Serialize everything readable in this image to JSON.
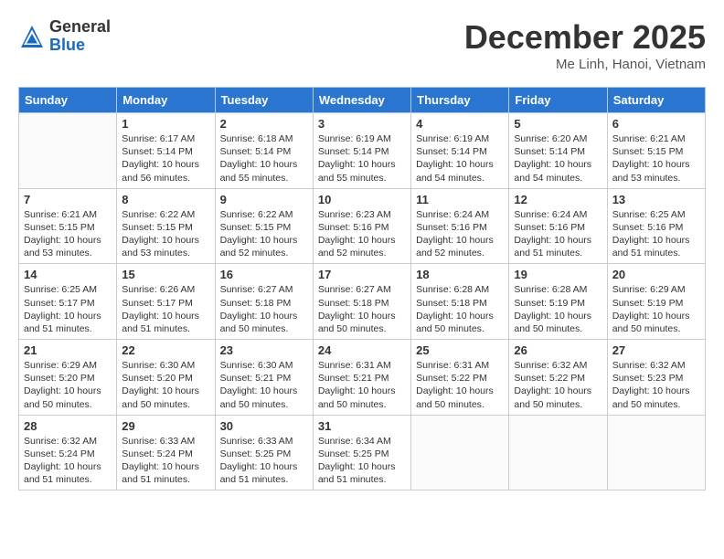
{
  "header": {
    "logo_general": "General",
    "logo_blue": "Blue",
    "month_title": "December 2025",
    "location": "Me Linh, Hanoi, Vietnam"
  },
  "calendar": {
    "days_of_week": [
      "Sunday",
      "Monday",
      "Tuesday",
      "Wednesday",
      "Thursday",
      "Friday",
      "Saturday"
    ],
    "weeks": [
      [
        {
          "day": "",
          "info": ""
        },
        {
          "day": "1",
          "info": "Sunrise: 6:17 AM\nSunset: 5:14 PM\nDaylight: 10 hours\nand 56 minutes."
        },
        {
          "day": "2",
          "info": "Sunrise: 6:18 AM\nSunset: 5:14 PM\nDaylight: 10 hours\nand 55 minutes."
        },
        {
          "day": "3",
          "info": "Sunrise: 6:19 AM\nSunset: 5:14 PM\nDaylight: 10 hours\nand 55 minutes."
        },
        {
          "day": "4",
          "info": "Sunrise: 6:19 AM\nSunset: 5:14 PM\nDaylight: 10 hours\nand 54 minutes."
        },
        {
          "day": "5",
          "info": "Sunrise: 6:20 AM\nSunset: 5:14 PM\nDaylight: 10 hours\nand 54 minutes."
        },
        {
          "day": "6",
          "info": "Sunrise: 6:21 AM\nSunset: 5:15 PM\nDaylight: 10 hours\nand 53 minutes."
        }
      ],
      [
        {
          "day": "7",
          "info": "Sunrise: 6:21 AM\nSunset: 5:15 PM\nDaylight: 10 hours\nand 53 minutes."
        },
        {
          "day": "8",
          "info": "Sunrise: 6:22 AM\nSunset: 5:15 PM\nDaylight: 10 hours\nand 53 minutes."
        },
        {
          "day": "9",
          "info": "Sunrise: 6:22 AM\nSunset: 5:15 PM\nDaylight: 10 hours\nand 52 minutes."
        },
        {
          "day": "10",
          "info": "Sunrise: 6:23 AM\nSunset: 5:16 PM\nDaylight: 10 hours\nand 52 minutes."
        },
        {
          "day": "11",
          "info": "Sunrise: 6:24 AM\nSunset: 5:16 PM\nDaylight: 10 hours\nand 52 minutes."
        },
        {
          "day": "12",
          "info": "Sunrise: 6:24 AM\nSunset: 5:16 PM\nDaylight: 10 hours\nand 51 minutes."
        },
        {
          "day": "13",
          "info": "Sunrise: 6:25 AM\nSunset: 5:16 PM\nDaylight: 10 hours\nand 51 minutes."
        }
      ],
      [
        {
          "day": "14",
          "info": "Sunrise: 6:25 AM\nSunset: 5:17 PM\nDaylight: 10 hours\nand 51 minutes."
        },
        {
          "day": "15",
          "info": "Sunrise: 6:26 AM\nSunset: 5:17 PM\nDaylight: 10 hours\nand 51 minutes."
        },
        {
          "day": "16",
          "info": "Sunrise: 6:27 AM\nSunset: 5:18 PM\nDaylight: 10 hours\nand 50 minutes."
        },
        {
          "day": "17",
          "info": "Sunrise: 6:27 AM\nSunset: 5:18 PM\nDaylight: 10 hours\nand 50 minutes."
        },
        {
          "day": "18",
          "info": "Sunrise: 6:28 AM\nSunset: 5:18 PM\nDaylight: 10 hours\nand 50 minutes."
        },
        {
          "day": "19",
          "info": "Sunrise: 6:28 AM\nSunset: 5:19 PM\nDaylight: 10 hours\nand 50 minutes."
        },
        {
          "day": "20",
          "info": "Sunrise: 6:29 AM\nSunset: 5:19 PM\nDaylight: 10 hours\nand 50 minutes."
        }
      ],
      [
        {
          "day": "21",
          "info": "Sunrise: 6:29 AM\nSunset: 5:20 PM\nDaylight: 10 hours\nand 50 minutes."
        },
        {
          "day": "22",
          "info": "Sunrise: 6:30 AM\nSunset: 5:20 PM\nDaylight: 10 hours\nand 50 minutes."
        },
        {
          "day": "23",
          "info": "Sunrise: 6:30 AM\nSunset: 5:21 PM\nDaylight: 10 hours\nand 50 minutes."
        },
        {
          "day": "24",
          "info": "Sunrise: 6:31 AM\nSunset: 5:21 PM\nDaylight: 10 hours\nand 50 minutes."
        },
        {
          "day": "25",
          "info": "Sunrise: 6:31 AM\nSunset: 5:22 PM\nDaylight: 10 hours\nand 50 minutes."
        },
        {
          "day": "26",
          "info": "Sunrise: 6:32 AM\nSunset: 5:22 PM\nDaylight: 10 hours\nand 50 minutes."
        },
        {
          "day": "27",
          "info": "Sunrise: 6:32 AM\nSunset: 5:23 PM\nDaylight: 10 hours\nand 50 minutes."
        }
      ],
      [
        {
          "day": "28",
          "info": "Sunrise: 6:32 AM\nSunset: 5:24 PM\nDaylight: 10 hours\nand 51 minutes."
        },
        {
          "day": "29",
          "info": "Sunrise: 6:33 AM\nSunset: 5:24 PM\nDaylight: 10 hours\nand 51 minutes."
        },
        {
          "day": "30",
          "info": "Sunrise: 6:33 AM\nSunset: 5:25 PM\nDaylight: 10 hours\nand 51 minutes."
        },
        {
          "day": "31",
          "info": "Sunrise: 6:34 AM\nSunset: 5:25 PM\nDaylight: 10 hours\nand 51 minutes."
        },
        {
          "day": "",
          "info": ""
        },
        {
          "day": "",
          "info": ""
        },
        {
          "day": "",
          "info": ""
        }
      ]
    ]
  }
}
